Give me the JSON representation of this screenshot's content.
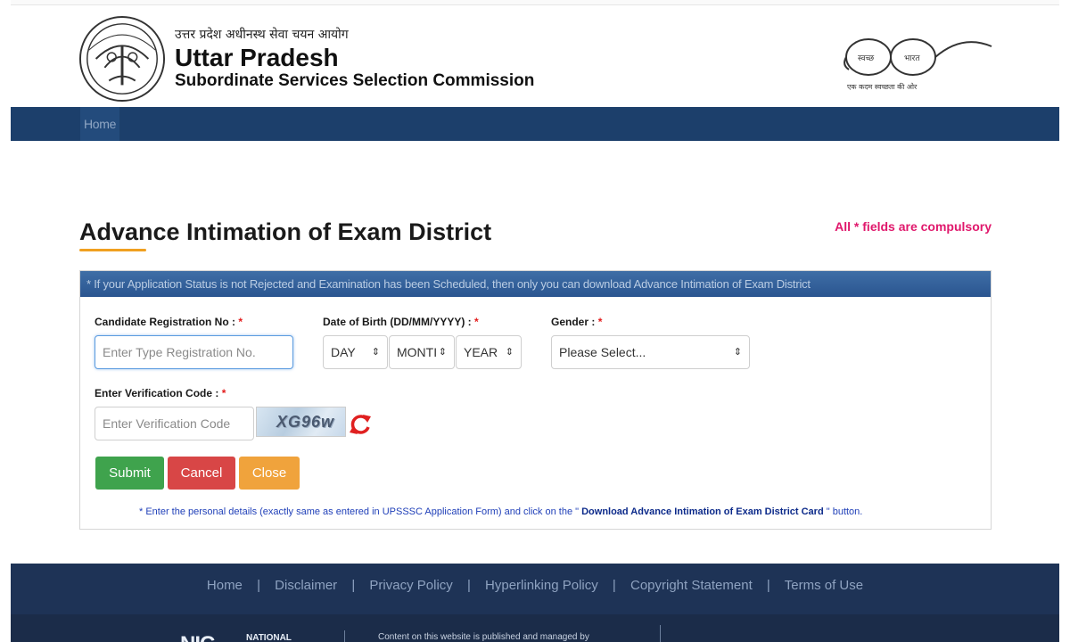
{
  "header": {
    "hindi_name": "उत्तर प्रदेश अधीनस्थ सेवा चयन आयोग",
    "title": "Uttar Pradesh",
    "subtitle": "Subordinate Services Selection Commission",
    "emblem_icon": "up-state-emblem-icon",
    "swachh_logo": {
      "left_word": "स्वच्छ",
      "right_word": "भारत",
      "caption": "एक कदम स्वच्छता की ओर"
    }
  },
  "nav": {
    "items": [
      "Home"
    ],
    "bar_color": "#1c3f6b"
  },
  "page": {
    "title": "Advance Intimation of Exam District",
    "compulsory_note": "All * fields are compulsory",
    "accent_color": "#f0a020"
  },
  "panel": {
    "header_note": "* If your Application Status is not Rejected and Examination has been Scheduled, then only you can download Advance Intimation of Exam District",
    "registration": {
      "label": "Candidate Registration No :",
      "required": "*",
      "placeholder": "Enter Type Registration No.",
      "value": ""
    },
    "dob": {
      "label": "Date of Birth (DD/MM/YYYY) :",
      "required": "*",
      "day": "DAY",
      "month": "MONTI",
      "year": "YEAR"
    },
    "gender": {
      "label": "Gender :",
      "required": "*",
      "selected": "Please Select..."
    },
    "verification": {
      "label": "Enter Verification Code :",
      "required": "*",
      "placeholder": "Enter Verification Code",
      "captcha_text": "XG96w",
      "refresh_icon": "refresh-icon"
    },
    "buttons": {
      "submit": "Submit",
      "cancel": "Cancel",
      "close": "Close"
    },
    "footnote": {
      "prefix": "* Enter the personal details (exactly same as entered in UPSSSC Application Form) and click on the \" ",
      "emphasis": "Download Advance Intimation of Exam District Card",
      "suffix": " \" button."
    }
  },
  "footer": {
    "links": [
      "Home",
      "Disclaimer",
      "Privacy Policy",
      "Hyperlinking Policy",
      "Copyright Statement",
      "Terms of Use"
    ],
    "separator": "|",
    "nic_logo": "NIC",
    "nic_text": "NATIONAL",
    "content_note": "Content on this website is published and managed by"
  }
}
